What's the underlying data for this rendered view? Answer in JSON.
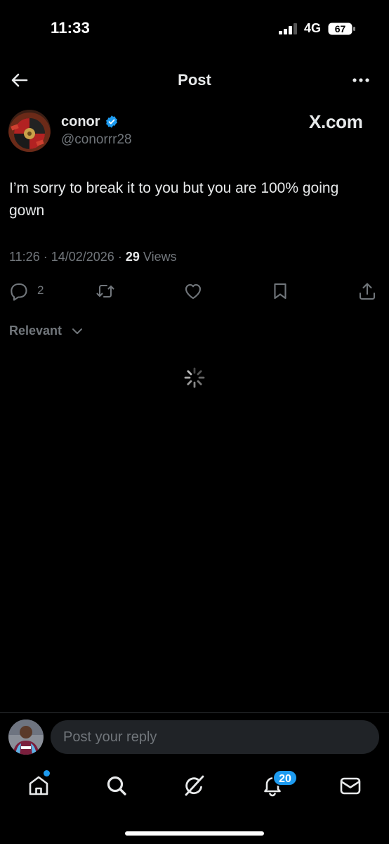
{
  "status_bar": {
    "time": "11:33",
    "network": "4G",
    "battery": "67"
  },
  "header": {
    "title": "Post"
  },
  "post": {
    "author_name": "conor",
    "handle": "@conorrr28",
    "source_label": "X.com",
    "text": "I’m sorry to break it to you but you are 100% going gown",
    "time": "11:26",
    "date": "14/02/2026",
    "views_count": "29",
    "views_label": "Views",
    "reply_count": "2"
  },
  "sort": {
    "label": "Relevant"
  },
  "reply_bar": {
    "placeholder": "Post your reply"
  },
  "nav": {
    "notifications_badge": "20"
  },
  "colors": {
    "accent": "#1d9bf0",
    "background": "#000000",
    "secondary_text": "#71767b"
  },
  "icons": [
    "back-arrow-icon",
    "more-icon",
    "verified-badge-icon",
    "reply-icon",
    "repost-icon",
    "like-icon",
    "bookmark-icon",
    "share-icon",
    "chevron-down-icon",
    "spinner-icon",
    "home-icon",
    "search-icon",
    "grok-icon",
    "bell-icon",
    "mail-icon"
  ]
}
